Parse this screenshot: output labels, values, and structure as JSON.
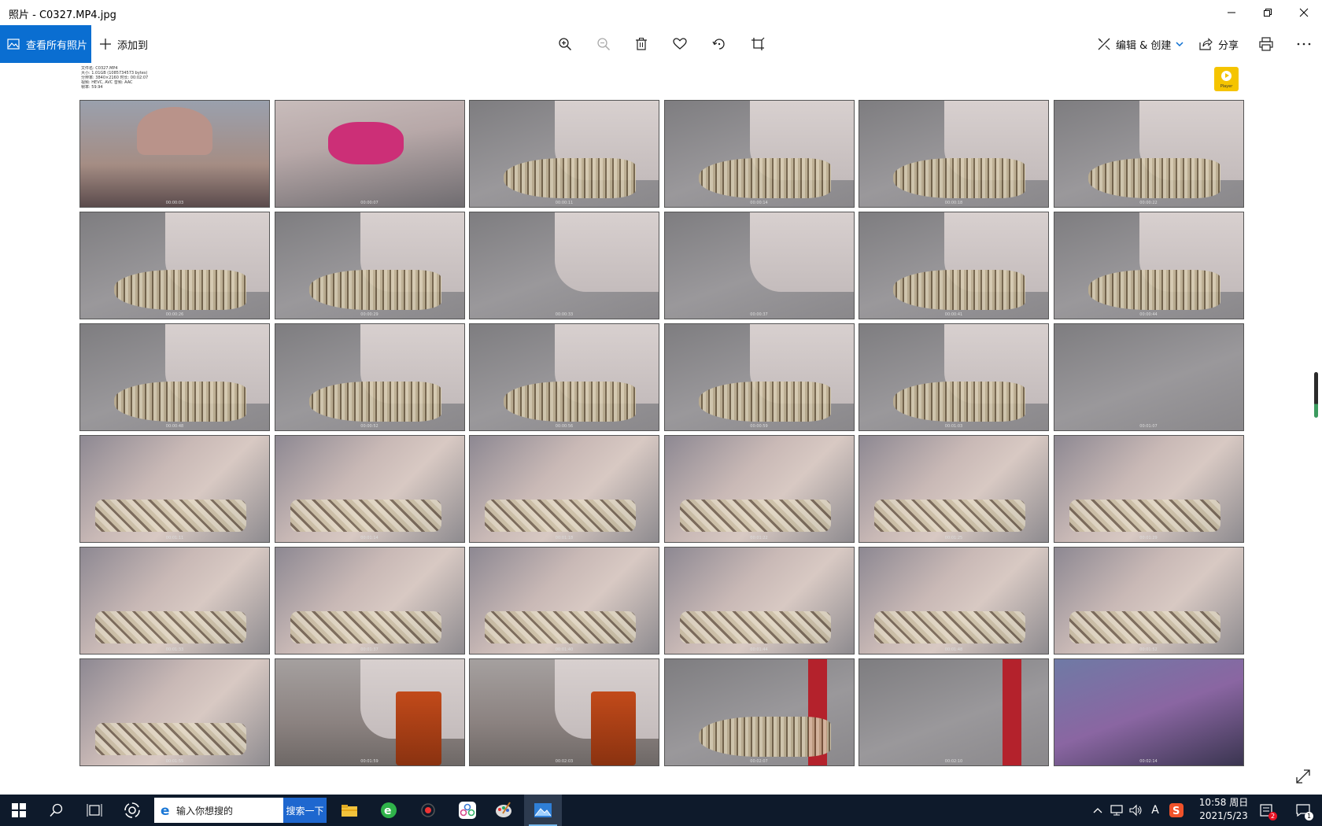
{
  "window": {
    "title": "照片 - C0327.MP4.jpg",
    "controls": [
      "minimize",
      "restore",
      "close"
    ]
  },
  "toolbar": {
    "view_all_label": "查看所有照片",
    "add_to_label": "添加到",
    "zoom_in_icon": "zoom-in-icon",
    "zoom_out_icon": "zoom-out-icon",
    "delete_icon": "trash-icon",
    "favorite_icon": "heart-icon",
    "rotate_icon": "rotate-icon",
    "crop_icon": "crop-icon",
    "edit_label": "编辑 & 创建",
    "share_label": "分享",
    "print_icon": "print-icon",
    "more_icon": "more-icon"
  },
  "sheet": {
    "info_lines": [
      "文件名: C0327.MP4",
      "大小: 1.01GB (1085734573 bytes)",
      "分辨率: 3840×2160 时长: 00:02:07",
      "视频: HEVC, AVC 音频: AAC",
      "帧率: 59.94"
    ],
    "player_label": "Player",
    "thumbnails": [
      {
        "ts": "00:00:03",
        "style": "person"
      },
      {
        "ts": "00:00:07",
        "style": "lap"
      },
      {
        "ts": "00:00:11",
        "style": "pavement shoe pants"
      },
      {
        "ts": "00:00:14",
        "style": "pavement shoe pants"
      },
      {
        "ts": "00:00:18",
        "style": "pavement shoe pants"
      },
      {
        "ts": "00:00:22",
        "style": "pavement shoe pants"
      },
      {
        "ts": "00:00:26",
        "style": "pavement shoe pants"
      },
      {
        "ts": "00:00:29",
        "style": "pavement shoe pants"
      },
      {
        "ts": "00:00:33",
        "style": "pavement pants"
      },
      {
        "ts": "00:00:37",
        "style": "pavement pants"
      },
      {
        "ts": "00:00:41",
        "style": "pavement shoe pants"
      },
      {
        "ts": "00:00:44",
        "style": "pavement shoe pants"
      },
      {
        "ts": "00:00:48",
        "style": "pavement shoe pants"
      },
      {
        "ts": "00:00:52",
        "style": "pavement shoe pants"
      },
      {
        "ts": "00:00:56",
        "style": "pavement shoe pants"
      },
      {
        "ts": "00:00:59",
        "style": "pavement shoe pants"
      },
      {
        "ts": "00:01:03",
        "style": "pavement shoe pants"
      },
      {
        "ts": "00:01:07",
        "style": "pavement"
      },
      {
        "ts": "00:01:11",
        "style": "closeup"
      },
      {
        "ts": "00:01:14",
        "style": "closeup"
      },
      {
        "ts": "00:01:18",
        "style": "closeup"
      },
      {
        "ts": "00:01:22",
        "style": "closeup"
      },
      {
        "ts": "00:01:25",
        "style": "closeup"
      },
      {
        "ts": "00:01:29",
        "style": "closeup"
      },
      {
        "ts": "00:01:33",
        "style": "closeup"
      },
      {
        "ts": "00:01:37",
        "style": "closeup"
      },
      {
        "ts": "00:01:40",
        "style": "closeup"
      },
      {
        "ts": "00:01:44",
        "style": "closeup"
      },
      {
        "ts": "00:01:48",
        "style": "closeup"
      },
      {
        "ts": "00:01:52",
        "style": "closeup"
      },
      {
        "ts": "00:01:55",
        "style": "closeup"
      },
      {
        "ts": "00:01:59",
        "style": "street pants"
      },
      {
        "ts": "00:02:03",
        "style": "street pants"
      },
      {
        "ts": "00:02:07",
        "style": "pavement red shoe"
      },
      {
        "ts": "00:02:10",
        "style": "pavement red"
      },
      {
        "ts": "00:02:14",
        "style": "bus"
      }
    ]
  },
  "taskbar": {
    "search_placeholder": "输入你想搜的",
    "search_button": "搜索一下",
    "time": "10:58 周日",
    "date": "2021/5/23",
    "tray_ime": "A",
    "tray_badge": "2",
    "notif_badge": "1"
  },
  "colors": {
    "accent": "#0a6ed1",
    "taskbar": "#0e1a2b",
    "search_button": "#1e67cf"
  }
}
